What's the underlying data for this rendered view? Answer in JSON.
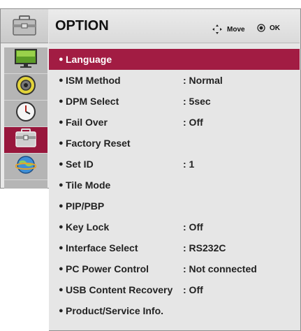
{
  "header": {
    "title": "OPTION",
    "move_label": "Move",
    "ok_label": "OK"
  },
  "sidebar": {
    "items": [
      {
        "icon": "picture-icon",
        "active": false
      },
      {
        "icon": "audio-icon",
        "active": false
      },
      {
        "icon": "time-icon",
        "active": false
      },
      {
        "icon": "option-toolbox-icon",
        "active": true
      },
      {
        "icon": "network-icon",
        "active": false
      }
    ]
  },
  "menu": {
    "items": [
      {
        "label": "Language",
        "value": "",
        "selected": true
      },
      {
        "label": "ISM Method",
        "value": ": Normal"
      },
      {
        "label": "DPM Select",
        "value": ": 5sec"
      },
      {
        "label": "Fail Over",
        "value": ": Off"
      },
      {
        "label": "Factory Reset",
        "value": ""
      },
      {
        "label": "Set ID",
        "value": ": 1"
      },
      {
        "label": "Tile Mode",
        "value": ""
      },
      {
        "label": "PIP/PBP",
        "value": ""
      },
      {
        "label": "Key Lock",
        "value": ": Off"
      },
      {
        "label": "Interface Select",
        "value": ": RS232C"
      },
      {
        "label": "PC Power Control",
        "value": ": Not connected"
      },
      {
        "label": "USB Content Recovery",
        "value": ": Off"
      },
      {
        "label": "Product/Service Info.",
        "value": ""
      }
    ]
  },
  "colors": {
    "accent": "#a21c43",
    "panel": "#e6e6e6"
  }
}
